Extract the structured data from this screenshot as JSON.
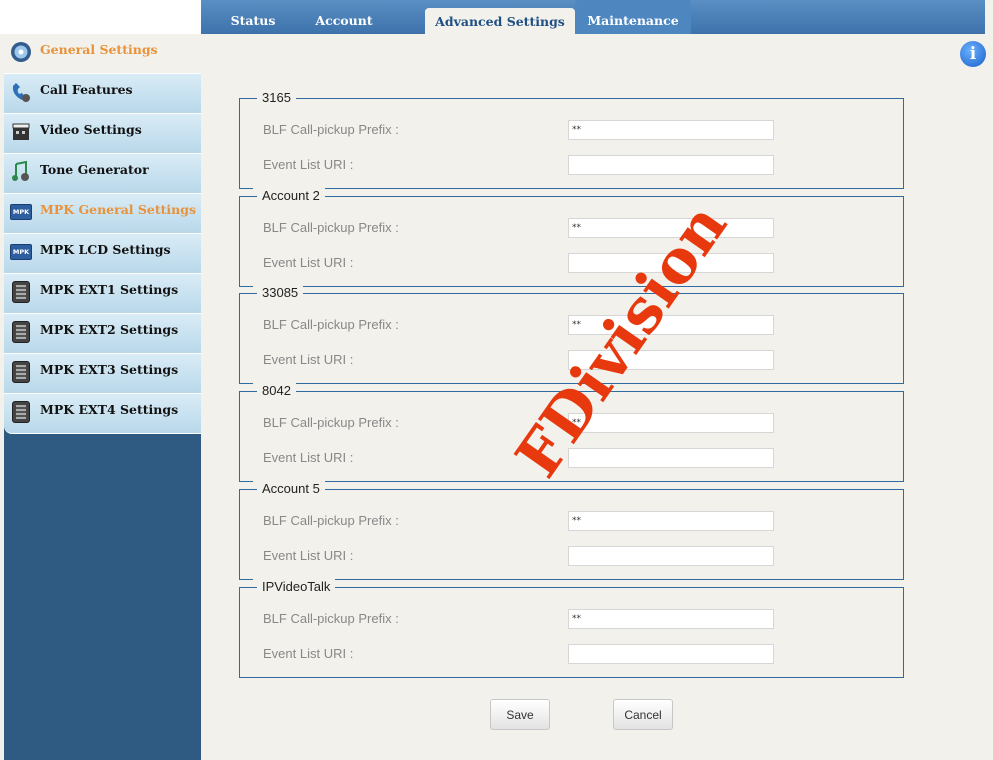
{
  "tabs": [
    "Status",
    "Account",
    "Advanced Settings",
    "Maintenance"
  ],
  "sidebar": {
    "items": [
      {
        "label": "General Settings",
        "icon": "settings-disc-icon"
      },
      {
        "label": "Call Features",
        "icon": "phone-handset-icon"
      },
      {
        "label": "Video Settings",
        "icon": "film-clapper-icon"
      },
      {
        "label": "Tone Generator",
        "icon": "music-note-icon"
      },
      {
        "label": "MPK General Settings",
        "icon": "mpk-icon"
      },
      {
        "label": "MPK LCD Settings",
        "icon": "mpk-icon"
      },
      {
        "label": "MPK EXT1 Settings",
        "icon": "extension-module-icon"
      },
      {
        "label": "MPK EXT2 Settings",
        "icon": "extension-module-icon"
      },
      {
        "label": "MPK EXT3 Settings",
        "icon": "extension-module-icon"
      },
      {
        "label": "MPK EXT4 Settings",
        "icon": "extension-module-icon"
      }
    ],
    "mpk_icon_text": "MPK"
  },
  "accounts": [
    {
      "name": "3165",
      "prefix_label": "BLF Call-pickup Prefix :",
      "prefix_value": "**",
      "uri_label": "Event List URI :",
      "uri_value": ""
    },
    {
      "name": "Account 2",
      "prefix_label": "BLF Call-pickup Prefix :",
      "prefix_value": "**",
      "uri_label": "Event List URI :",
      "uri_value": ""
    },
    {
      "name": "33085",
      "prefix_label": "BLF Call-pickup Prefix :",
      "prefix_value": "**",
      "uri_label": "Event List URI :",
      "uri_value": ""
    },
    {
      "name": "8042",
      "prefix_label": "BLF Call-pickup Prefix :",
      "prefix_value": "**",
      "uri_label": "Event List URI :",
      "uri_value": ""
    },
    {
      "name": "Account 5",
      "prefix_label": "BLF Call-pickup Prefix :",
      "prefix_value": "**",
      "uri_label": "Event List URI :",
      "uri_value": ""
    },
    {
      "name": "IPVideoTalk",
      "prefix_label": "BLF Call-pickup Prefix :",
      "prefix_value": "**",
      "uri_label": "Event List URI :",
      "uri_value": ""
    }
  ],
  "buttons": {
    "save": "Save",
    "cancel": "Cancel"
  },
  "info_icon": "i",
  "watermark": "FDivision"
}
